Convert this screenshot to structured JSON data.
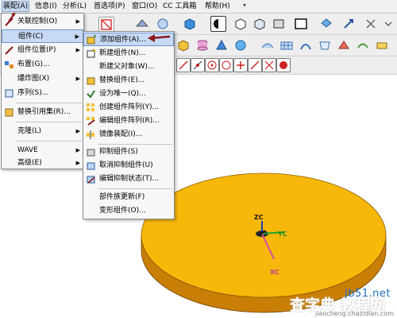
{
  "menubar": {
    "items": [
      "装配(A)",
      "信息(I)",
      "分析(L)",
      "首选项(P)",
      "窗口(O)",
      "CC 工具箱",
      "帮助(H)"
    ]
  },
  "assembly_menu": {
    "items": [
      {
        "label": "关联控制(O)",
        "has_submenu": true
      },
      {
        "label": "组件(C)",
        "has_submenu": true,
        "highlighted": true
      },
      {
        "label": "组件位置(P)",
        "has_submenu": true
      },
      {
        "label": "布置(G)..."
      },
      {
        "label": "爆炸图(X)",
        "has_submenu": true
      },
      {
        "label": "序列(S)..."
      },
      {
        "label": "替换引用集(R)..."
      },
      {
        "label": "克隆(L)",
        "has_submenu": true
      },
      {
        "label": "WAVE",
        "has_submenu": true
      },
      {
        "label": "高级(E)",
        "has_submenu": true
      }
    ]
  },
  "component_submenu": {
    "items": [
      {
        "label": "添加组件(A)...",
        "highlighted": true
      },
      {
        "label": "新建组件(N)..."
      },
      {
        "label": "新建父对象(W)..."
      },
      {
        "label": "替换组件(E)..."
      },
      {
        "label": "设为唯一(Q)..."
      },
      {
        "label": "创建组件阵列(Y)..."
      },
      {
        "label": "编辑组件阵列(R)..."
      },
      {
        "label": "镜像装配(I)..."
      },
      {
        "label": "抑制组件(S)"
      },
      {
        "label": "取消抑制组件(U)"
      },
      {
        "label": "编辑抑制状态(T)..."
      },
      {
        "label": "部件族更新(F)"
      },
      {
        "label": "变形组件(O)..."
      }
    ]
  },
  "viewport": {
    "axis_labels": {
      "z": "ZC",
      "y": "YC",
      "x": "XC"
    }
  },
  "watermark": {
    "site": "jb51.net",
    "brand": "查字典 教程网",
    "url": "jiaocheng.chazidian.com"
  },
  "colors": {
    "disc_top": "#f7b80a",
    "disc_side": "#c97e05",
    "menu_highlight": "#c7d9f4",
    "annotation_arrow": "#8b1a1a"
  }
}
